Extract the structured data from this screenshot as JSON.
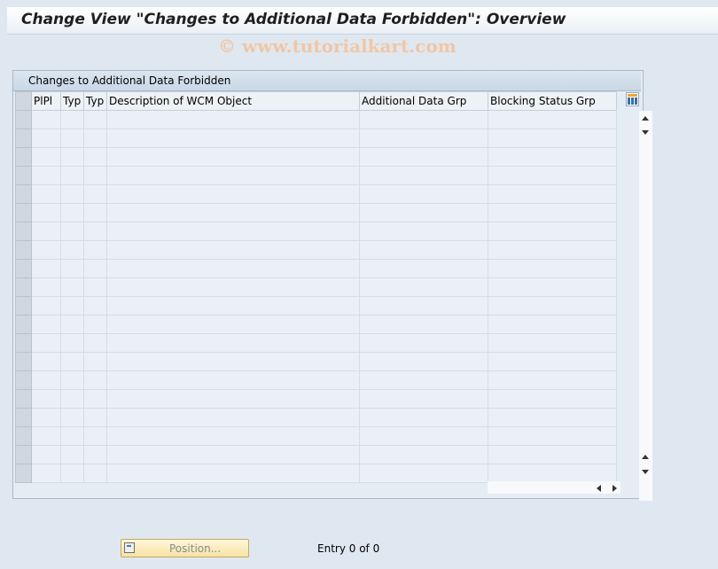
{
  "window": {
    "title": "Change View \"Changes to Additional Data Forbidden\": Overview"
  },
  "watermark": "© www.tutorialkart.com",
  "panel": {
    "title": "Changes to Additional Data Forbidden"
  },
  "table": {
    "columns": [
      "PlPl",
      "Typ",
      "Typ",
      "Description of WCM Object",
      "Additional Data Grp",
      "Blocking Status Grp"
    ],
    "row_count": 20,
    "rows": []
  },
  "footer": {
    "position_label": "Position...",
    "entry_text": "Entry 0 of 0"
  },
  "icons": {
    "column_settings": "column-settings-icon",
    "position": "position-icon"
  }
}
